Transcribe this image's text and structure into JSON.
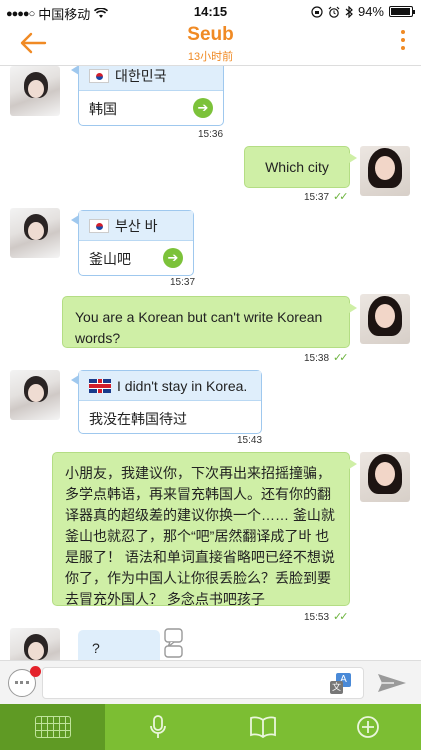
{
  "status_bar": {
    "signal": "●●●●○",
    "carrier": "中国移动",
    "time": "14:15",
    "battery": "94%",
    "battery_level": 0.94
  },
  "header": {
    "title": "Seub",
    "subtitle": "13小时前"
  },
  "messages": [
    {
      "from": "other",
      "original": "대한민국",
      "translation": "韩国",
      "time": "15:36"
    },
    {
      "from": "me",
      "text": "Which city",
      "time": "15:37"
    },
    {
      "from": "other",
      "original": "부산 바",
      "translation": "釜山吧",
      "time": "15:37"
    },
    {
      "from": "me",
      "text": "You are a Korean but can't write Korean words?",
      "time": "15:38"
    },
    {
      "from": "other",
      "original": "I didn't stay in Korea.",
      "translation": "我没在韩国待过",
      "time": "15:43"
    },
    {
      "from": "me",
      "text": "小朋友，我建议你，下次再出来招摇撞骗，多学点韩语，再来冒充韩国人。还有你的翻译器真的超级差的建议你换一个…… 釜山就釜山也就忍了，那个“吧”居然翻译成了바 也是服了！ 语法和单词直接省略吧已经不想说你了，作为中国人让你很丢脸么？丢脸到要去冒充外国人？ 多念点书吧孩子",
      "time": "15:53"
    },
    {
      "from": "other",
      "text": "?"
    }
  ],
  "input": {
    "value": "",
    "placeholder": "",
    "translate_a": "A",
    "translate_b": "文"
  },
  "tabs": [
    "keyboard",
    "microphone",
    "book",
    "add"
  ],
  "colors": {
    "accent": "#f08a24",
    "green_bubble": "#cfefa6",
    "blue_bubble": "#dfeefb",
    "tab_bar": "#7cbe33"
  }
}
